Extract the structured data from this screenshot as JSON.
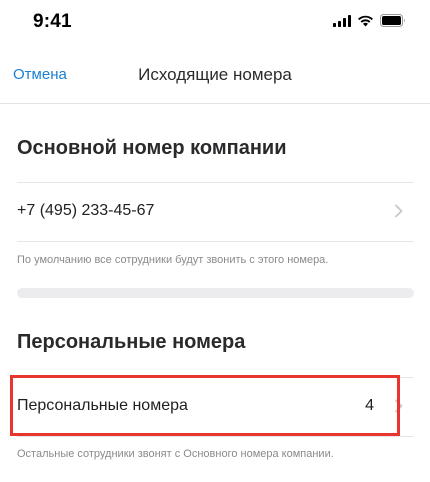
{
  "status_bar": {
    "time": "9:41",
    "icons": [
      "signal-icon",
      "wifi-icon",
      "battery-icon"
    ]
  },
  "nav": {
    "cancel_label": "Отмена",
    "title": "Исходящие номера"
  },
  "main_number_section": {
    "title": "Основной номер компании",
    "number": "+7 (495) 233-45-67",
    "caption": "По умолчанию все сотрудники будут звонить с этого номера."
  },
  "personal_section": {
    "title": "Персональные номера",
    "row_label": "Персональные номера",
    "row_count": "4",
    "caption": "Остальные сотрудники звонят с Основного номера компании."
  },
  "colors": {
    "accent": "#1a7fd4",
    "highlight": "#e8352d"
  }
}
